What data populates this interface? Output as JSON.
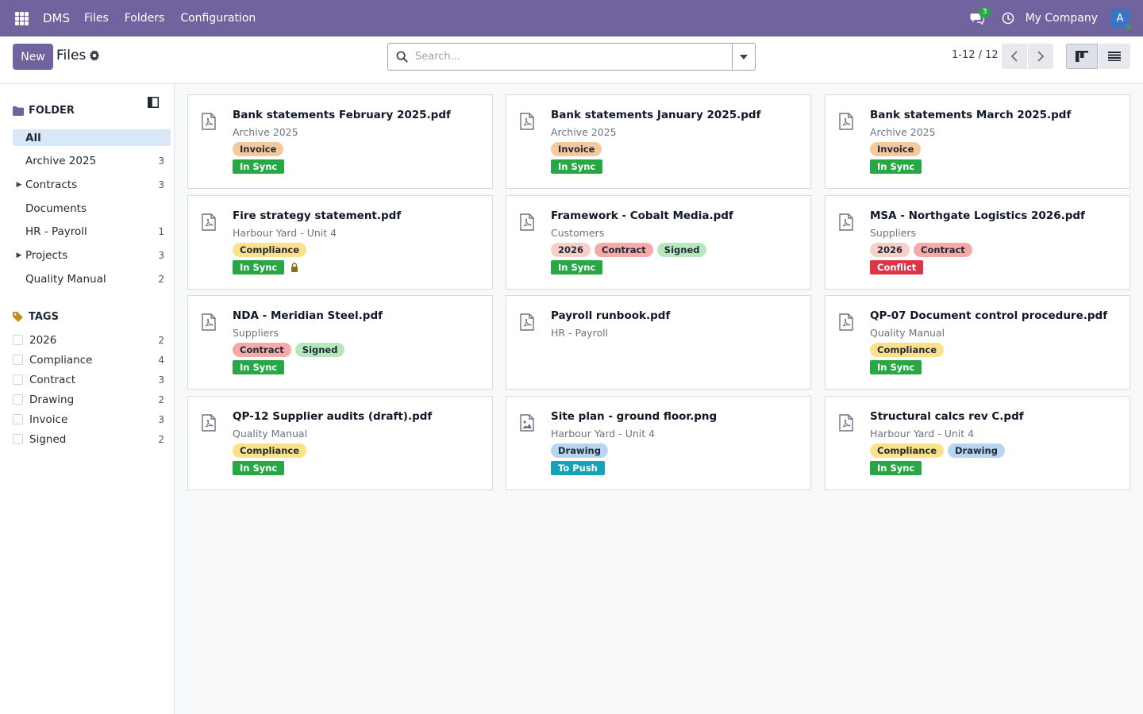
{
  "navbar": {
    "brand": "DMS",
    "menu": [
      "Files",
      "Folders",
      "Configuration"
    ],
    "chat_count": "3",
    "company": "My Company",
    "avatar_letter": "A",
    "color": "#71639e"
  },
  "control": {
    "new_label": "New",
    "title": "Files",
    "search_placeholder": "Search...",
    "pager": "1-12 / 12"
  },
  "sidebar": {
    "folder_header": "FOLDER",
    "folders": [
      {
        "label": "All",
        "count": "",
        "caret": false,
        "active": true
      },
      {
        "label": "Archive 2025",
        "count": "3",
        "caret": false
      },
      {
        "label": "Contracts",
        "count": "3",
        "caret": true
      },
      {
        "label": "Documents",
        "count": "",
        "caret": false
      },
      {
        "label": "HR - Payroll",
        "count": "1",
        "caret": false
      },
      {
        "label": "Projects",
        "count": "3",
        "caret": true
      },
      {
        "label": "Quality Manual",
        "count": "2",
        "caret": false
      }
    ],
    "tags_header": "TAGS",
    "tags": [
      {
        "label": "2026",
        "count": "2"
      },
      {
        "label": "Compliance",
        "count": "4"
      },
      {
        "label": "Contract",
        "count": "3"
      },
      {
        "label": "Drawing",
        "count": "2"
      },
      {
        "label": "Invoice",
        "count": "3"
      },
      {
        "label": "Signed",
        "count": "2"
      }
    ]
  },
  "tag_colors": {
    "Invoice": "#f5c9a0",
    "Compliance": "#fbe28a",
    "2026": "#f7d0c8",
    "Contract": "#f6a9a9",
    "Signed": "#b9e7bd",
    "Drawing": "#b7d4f0"
  },
  "status_colors": {
    "In Sync": "#28a745",
    "Conflict": "#dc3545",
    "To Push": "#17a2b8"
  },
  "files": [
    {
      "name": "Bank statements February 2025.pdf",
      "folder": "Archive 2025",
      "tags": [
        "Invoice"
      ],
      "status": "In Sync",
      "icon": "pdf-icon"
    },
    {
      "name": "Bank statements January 2025.pdf",
      "folder": "Archive 2025",
      "tags": [
        "Invoice"
      ],
      "status": "In Sync",
      "icon": "pdf-icon"
    },
    {
      "name": "Bank statements March 2025.pdf",
      "folder": "Archive 2025",
      "tags": [
        "Invoice"
      ],
      "status": "In Sync",
      "icon": "pdf-icon"
    },
    {
      "name": "Fire strategy statement.pdf",
      "folder": "Harbour Yard - Unit 4",
      "tags": [
        "Compliance"
      ],
      "status": "In Sync",
      "locked": true,
      "icon": "pdf-icon"
    },
    {
      "name": "Framework - Cobalt Media.pdf",
      "folder": "Customers",
      "tags": [
        "2026",
        "Contract",
        "Signed"
      ],
      "status": "In Sync",
      "icon": "pdf-icon"
    },
    {
      "name": "MSA - Northgate Logistics 2026.pdf",
      "folder": "Suppliers",
      "tags": [
        "2026",
        "Contract"
      ],
      "status": "Conflict",
      "icon": "pdf-icon"
    },
    {
      "name": "NDA - Meridian Steel.pdf",
      "folder": "Suppliers",
      "tags": [
        "Contract",
        "Signed"
      ],
      "status": "In Sync",
      "icon": "pdf-icon"
    },
    {
      "name": "Payroll runbook.pdf",
      "folder": "HR - Payroll",
      "tags": [],
      "status": "",
      "icon": "pdf-icon"
    },
    {
      "name": "QP-07 Document control procedure.pdf",
      "folder": "Quality Manual",
      "tags": [
        "Compliance"
      ],
      "status": "In Sync",
      "icon": "pdf-icon"
    },
    {
      "name": "QP-12 Supplier audits (draft).pdf",
      "folder": "Quality Manual",
      "tags": [
        "Compliance"
      ],
      "status": "In Sync",
      "icon": "pdf-icon"
    },
    {
      "name": "Site plan - ground floor.png",
      "folder": "Harbour Yard - Unit 4",
      "tags": [
        "Drawing"
      ],
      "status": "To Push",
      "icon": "image-icon"
    },
    {
      "name": "Structural calcs rev C.pdf",
      "folder": "Harbour Yard - Unit 4",
      "tags": [
        "Compliance",
        "Drawing"
      ],
      "status": "In Sync",
      "icon": "pdf-icon"
    }
  ]
}
